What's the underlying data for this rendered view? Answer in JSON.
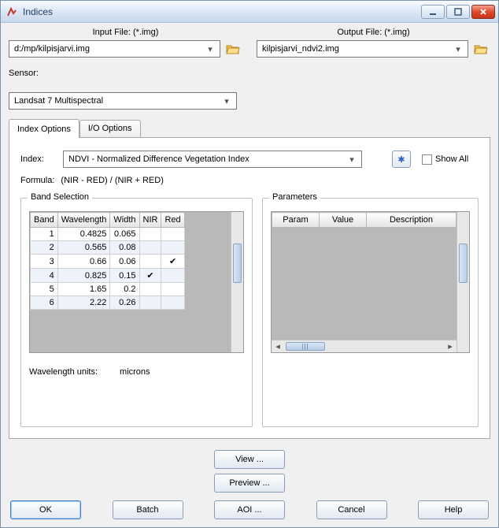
{
  "window": {
    "title": "Indices"
  },
  "files": {
    "input_label": "Input File: (*.img)",
    "input_value": "d:/mp/kilpisjarvi.img",
    "output_label": "Output File: (*.img)",
    "output_value": "kilpisjarvi_ndvi2.img"
  },
  "sensor": {
    "label": "Sensor:",
    "value": "Landsat 7 Multispectral"
  },
  "tabs": {
    "index_options": "Index Options",
    "io_options": "I/O Options"
  },
  "index": {
    "label": "Index:",
    "value": "NDVI - Normalized Difference Vegetation Index",
    "show_all_label": "Show All"
  },
  "formula": {
    "label": "Formula:",
    "value": "(NIR - RED) / (NIR + RED)"
  },
  "band_selection": {
    "legend": "Band Selection",
    "headers": {
      "band": "Band",
      "wavelength": "Wavelength",
      "width": "Width",
      "nir": "NIR",
      "red": "Red"
    },
    "rows": [
      {
        "band": "1",
        "wavelength": "0.4825",
        "width": "0.065",
        "nir": "",
        "red": ""
      },
      {
        "band": "2",
        "wavelength": "0.565",
        "width": "0.08",
        "nir": "",
        "red": ""
      },
      {
        "band": "3",
        "wavelength": "0.66",
        "width": "0.06",
        "nir": "",
        "red": "✔"
      },
      {
        "band": "4",
        "wavelength": "0.825",
        "width": "0.15",
        "nir": "✔",
        "red": ""
      },
      {
        "band": "5",
        "wavelength": "1.65",
        "width": "0.2",
        "nir": "",
        "red": ""
      },
      {
        "band": "6",
        "wavelength": "2.22",
        "width": "0.26",
        "nir": "",
        "red": ""
      }
    ],
    "units_label": "Wavelength units:",
    "units_value": "microns"
  },
  "parameters": {
    "legend": "Parameters",
    "headers": {
      "param": "Param",
      "value": "Value",
      "description": "Description"
    }
  },
  "buttons": {
    "view": "View ...",
    "preview": "Preview ...",
    "ok": "OK",
    "batch": "Batch",
    "aoi": "AOI ...",
    "cancel": "Cancel",
    "help": "Help"
  }
}
